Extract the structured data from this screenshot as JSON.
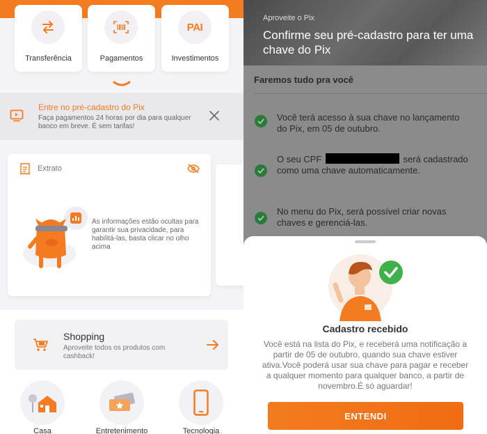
{
  "left_screen": {
    "quick_actions": [
      {
        "label": "Transferência",
        "icon": "transfer-arrows-icon"
      },
      {
        "label": "Pagamentos",
        "icon": "barcode-icon"
      },
      {
        "label": "Investimentos",
        "icon": "pai-logo",
        "logo_text": "PAI"
      }
    ],
    "pix_banner": {
      "title": "Entre no pré-cadastro do Pix",
      "description": "Faça pagamentos 24 horas por dia para qualquer banco em breve. É sem tarifas!"
    },
    "extrato": {
      "title": "Extrato",
      "hidden_message": "As informações estão ocultas para garantir sua privacidade, para habilitá-las, basta clicar no olho acima"
    },
    "shopping": {
      "title": "Shopping",
      "description": "Aproveite todos os produtos com cashback!"
    },
    "categories": [
      {
        "label": "Casa"
      },
      {
        "label": "Entretenimento"
      },
      {
        "label": "Tecnologia"
      }
    ],
    "colors": {
      "accent": "#f47b20",
      "background": "#f4f3f7"
    }
  },
  "right_screen": {
    "hero": {
      "subtitle": "Aproveite o Pix",
      "title": "Confirme seu pré-cadastro para ter uma chave do Pix"
    },
    "section_title": "Faremos tudo pra você",
    "benefits": [
      {
        "text": "Você terá acesso à sua chave no lançamento do Pix, em 05 de outubro."
      },
      {
        "text_before": "O seu CPF",
        "text_after": "será cadastrado como uma chave automaticamente."
      },
      {
        "text": "No menu do Pix, será possível criar novas chaves e gerenciá-las."
      }
    ],
    "sheet": {
      "heading": "Cadastro recebido",
      "body": "Você está na lista do Pix, e receberá uma notificação a partir de 05 de outubro, quando sua chave estiver ativa.Você poderá usar sua chave para pagar e receber a qualquer momento para qualquer banco, a partir de novembro.É só aguardar!",
      "button_label": "ENTENDI"
    },
    "colors": {
      "check_green": "#2b7a3a",
      "success_green": "#3fb04a",
      "accent": "#f47b20"
    }
  }
}
